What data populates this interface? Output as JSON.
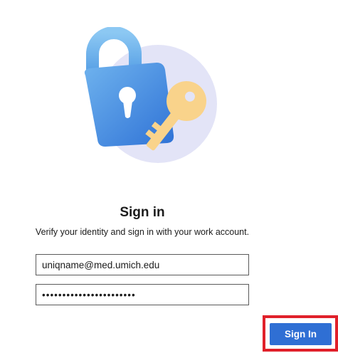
{
  "illustration": {
    "icon": "lock-and-key-icon",
    "colors": {
      "circle": "#e3e4f7",
      "lock_body": "#4a90e2",
      "lock_shackle": "#7ab8ee",
      "key": "#f9d38b"
    }
  },
  "heading": {
    "title": "Sign in",
    "subtitle": "Verify your identity and sign in with your work account."
  },
  "form": {
    "username_value": "uniqname@med.umich.edu",
    "password_value": "•••••••••••••••••••••••"
  },
  "actions": {
    "sign_in_label": "Sign In"
  },
  "colors": {
    "button": "#2f6fd4",
    "highlight": "#e0202a"
  }
}
